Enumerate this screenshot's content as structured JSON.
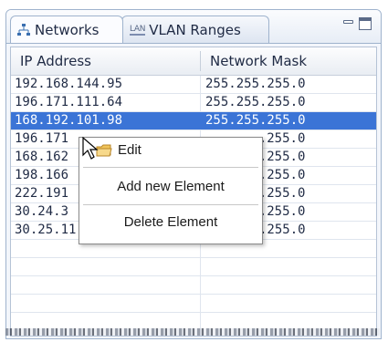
{
  "tabs": {
    "networks_label": "Networks",
    "vlan_label": "VLAN Ranges",
    "vlan_icon_text": "LAN"
  },
  "table": {
    "columns": [
      "IP Address",
      "Network Mask"
    ],
    "rows": [
      [
        "192.168.144.95",
        "255.255.255.0"
      ],
      [
        "196.171.111.64",
        "255.255.255.0"
      ],
      [
        "168.192.101.98",
        "255.255.255.0"
      ],
      [
        "196.171",
        ".255.0"
      ],
      [
        "168.162",
        ".255.0"
      ],
      [
        "198.166",
        ".255.0"
      ],
      [
        "222.191",
        ".255.0"
      ],
      [
        "30.24.3",
        ".255.0"
      ],
      [
        "30.25.11.0",
        "255.255.255.0"
      ],
      [
        "",
        ""
      ],
      [
        "",
        ""
      ],
      [
        "",
        ""
      ],
      [
        "",
        ""
      ]
    ],
    "selected_row": 2
  },
  "context_menu": {
    "edit": "Edit",
    "add": "Add new Element",
    "delete": "Delete Element"
  },
  "colors": {
    "selection": "#3b74d6",
    "tab_border": "#9fb3cd"
  }
}
